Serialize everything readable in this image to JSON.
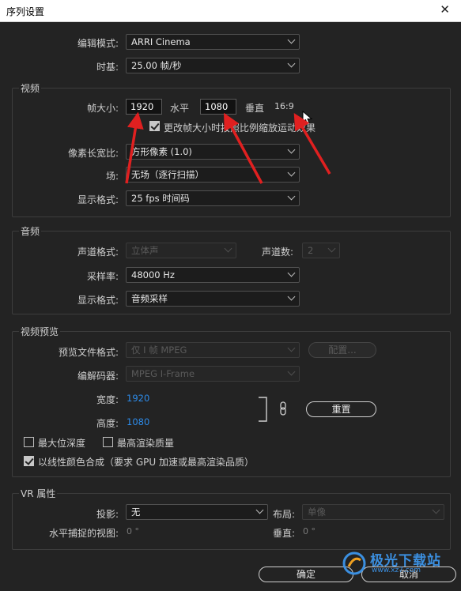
{
  "window": {
    "title": "序列设置",
    "close_glyph": "✕"
  },
  "top": {
    "edit_mode_label": "编辑模式:",
    "edit_mode_value": "ARRI Cinema",
    "timebase_label": "时基:",
    "timebase_value": "25.00  帧/秒"
  },
  "video": {
    "section_title": "视频",
    "frame_size_label": "帧大小:",
    "frame_width": "1920",
    "horizontal_label": "水平",
    "frame_height": "1080",
    "vertical_label": "垂直",
    "aspect_ratio": "16:9",
    "scale_checkbox_label": "更改帧大小时按照比例缩放运动效果",
    "scale_checkbox_checked": true,
    "pixel_aspect_label": "像素长宽比:",
    "pixel_aspect_value": "方形像素 (1.0)",
    "field_label": "场:",
    "field_value": "无场（逐行扫描）",
    "display_format_label": "显示格式:",
    "display_format_value": "25 fps 时间码"
  },
  "audio": {
    "section_title": "音频",
    "channel_format_label": "声道格式:",
    "channel_format_value": "立体声",
    "channel_count_label": "声道数:",
    "channel_count_value": "2",
    "sample_rate_label": "采样率:",
    "sample_rate_value": "48000 Hz",
    "display_format_label": "显示格式:",
    "display_format_value": "音频采样"
  },
  "preview": {
    "section_title": "视频预览",
    "file_format_label": "预览文件格式:",
    "file_format_value": "仅 I 帧 MPEG",
    "config_button": "配置...",
    "codec_label": "编解码器:",
    "codec_value": "MPEG I-Frame",
    "width_label": "宽度:",
    "width_value": "1920",
    "height_label": "高度:",
    "height_value": "1080",
    "reset_button": "重置",
    "max_bit_depth_label": "最大位深度",
    "max_bit_depth_checked": false,
    "max_render_quality_label": "最高渲染质量",
    "max_render_quality_checked": false,
    "linear_color_label": "以线性颜色合成（要求 GPU 加速或最高渲染品质）",
    "linear_color_checked": true
  },
  "vr": {
    "section_title": "VR 属性",
    "projection_label": "投影:",
    "projection_value": "无",
    "layout_label": "布局:",
    "layout_value": "单像",
    "h_fov_label": "水平捕捉的视图:",
    "h_fov_value": "0 °",
    "v_fov_label": "垂直:",
    "v_fov_value": "0 °"
  },
  "footer": {
    "ok_button": "确定",
    "cancel_button": "取消"
  },
  "watermark": {
    "text": "极光下载站",
    "url": "www.xz7.com"
  },
  "colors": {
    "accent_link": "#2d8ceb",
    "annotation_arrow": "#e02020",
    "background": "#232323"
  }
}
